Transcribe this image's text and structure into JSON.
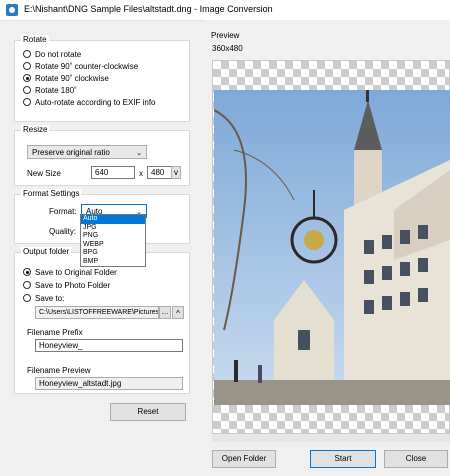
{
  "window": {
    "title": "E:\\Nishant\\DNG Sample Files\\altstadt.dng - Image Conversion"
  },
  "rotate": {
    "title": "Rotate",
    "options": [
      {
        "label": "Do not rotate",
        "checked": false
      },
      {
        "label": "Rotate 90˚ counter-clockwise",
        "checked": false
      },
      {
        "label": "Rotate 90˚ clockwise",
        "checked": true
      },
      {
        "label": "Rotate 180˚",
        "checked": false
      },
      {
        "label": "Auto-rotate according to EXIF info",
        "checked": false
      }
    ]
  },
  "resize": {
    "title": "Resize",
    "mode_value": "Preserve original ratio",
    "new_size_label": "New Size",
    "width": "640",
    "x_label": "x",
    "height": "480",
    "dropdown_button": "v"
  },
  "format": {
    "title": "Format Settings",
    "format_label": "Format:",
    "format_value": "Auto",
    "quality_label": "Quality:",
    "options": [
      "Auto",
      "JPG",
      "PNG",
      "WEBP",
      "BPG",
      "BMP"
    ],
    "selected_index": 0
  },
  "output": {
    "title": "Output folder",
    "options": [
      {
        "label": "Save to Original Folder",
        "checked": true
      },
      {
        "label": "Save to Photo Folder",
        "checked": false
      },
      {
        "label": "Save to:",
        "checked": false
      }
    ],
    "path_value": "C:\\Users\\LISTOFFREEWARE\\Pictures",
    "browse_label": "...",
    "up_button": "^",
    "prefix_label": "Filename Prefix",
    "prefix_value": "Honeyview_",
    "preview_label": "Filename Preview",
    "preview_value": "Honeyview_altstadt.jpg"
  },
  "buttons": {
    "reset": "Reset",
    "open_folder": "Open Folder",
    "start": "Start",
    "close": "Close"
  },
  "preview": {
    "title": "Preview",
    "dimensions": "360x480"
  },
  "colors": {
    "accent": "#0078d7",
    "selection": "#0078d7"
  },
  "icons": {
    "app": "image-icon",
    "combo_arrow": "chevron-down-icon"
  }
}
